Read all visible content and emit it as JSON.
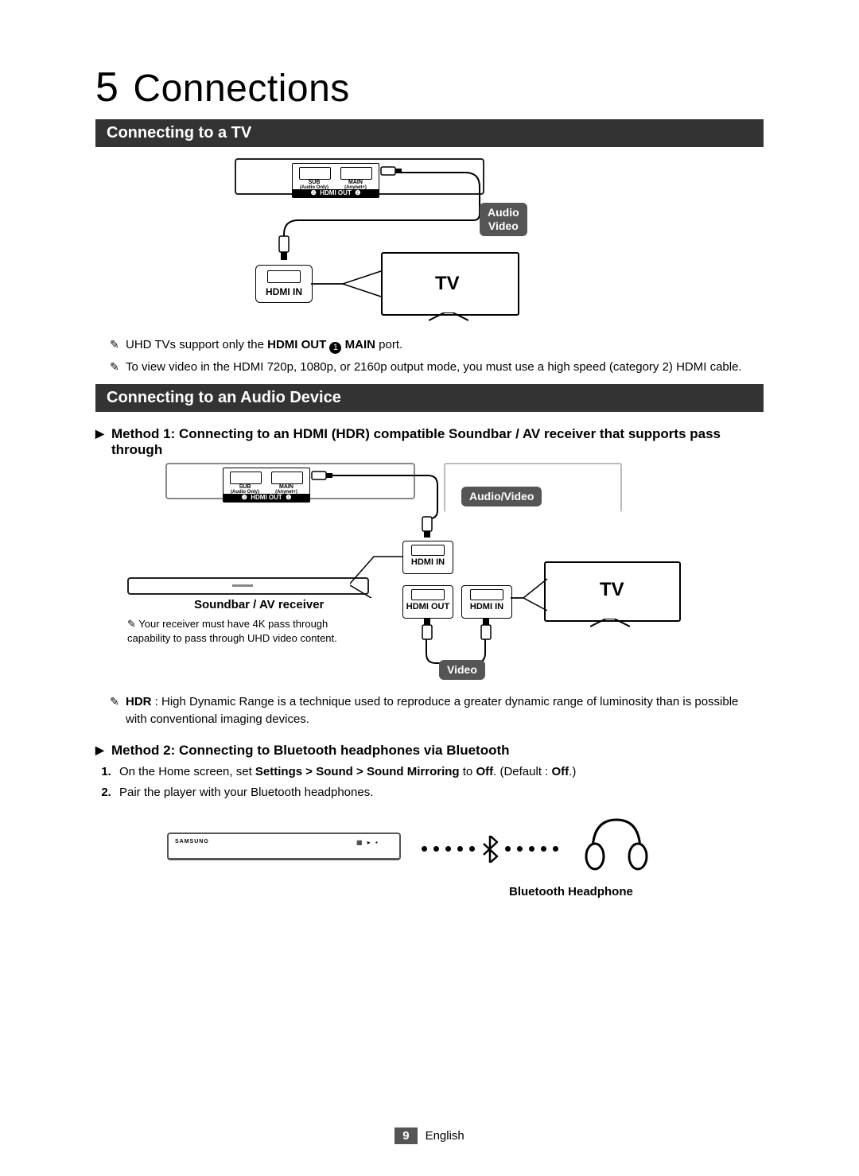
{
  "chapter": {
    "number": "5",
    "title": "Connections"
  },
  "section1": {
    "title": "Connecting to a TV",
    "diagram": {
      "pill_audio": "Audio",
      "pill_video": "Video",
      "tv": "TV",
      "hdmi_in": "HDMI IN",
      "hdmi_out_strip": "HDMI OUT",
      "sub": "SUB",
      "sub_sub": "(Audio Only)",
      "main": "MAIN",
      "main_sub": "(Anynet+)",
      "num1": "❶",
      "num2": "❷"
    },
    "notes": [
      {
        "pre": "UHD TVs support only the ",
        "b1": "HDMI OUT ",
        "circ": "1",
        "b2": " MAIN",
        "post": " port."
      },
      {
        "text": "To view video in the HDMI 720p, 1080p, or 2160p output mode, you must use a high speed (category 2) HDMI cable."
      }
    ]
  },
  "section2": {
    "title": "Connecting to an Audio Device",
    "method1": {
      "heading": "Method 1: Connecting to an HDMI (HDR) compatible Soundbar / AV receiver that supports pass through",
      "diagram": {
        "pill_av": "Audio/Video",
        "pill_video": "Video",
        "hdmi_in": "HDMI IN",
        "hdmi_out": "HDMI OUT",
        "tv": "TV",
        "soundbar_label": "Soundbar / AV receiver",
        "hdmi_out_strip": "HDMI OUT",
        "sub": "SUB",
        "sub_sub": "(Audio Only)",
        "main": "MAIN",
        "main_sub": "(Anynet+)",
        "num1": "❶",
        "num2": "❷",
        "note": "Your receiver must have 4K pass through capability to pass through UHD video content."
      },
      "hdr_note": {
        "b": "HDR",
        "text": " : High Dynamic Range is a technique used to reproduce a greater dynamic range of luminosity than is possible with conventional imaging devices."
      }
    },
    "method2": {
      "heading": "Method 2: Connecting to Bluetooth headphones via Bluetooth",
      "steps": [
        {
          "pre": "On the Home screen, set ",
          "b1": "Settings > Sound > Sound Mirroring",
          "mid": " to ",
          "b2": "Off",
          "mid2": ". (Default : ",
          "b3": "Off",
          "post": ".)"
        },
        {
          "text": "Pair the player with your Bluetooth headphones."
        }
      ],
      "headphone_label": "Bluetooth Headphone"
    }
  },
  "footer": {
    "page": "9",
    "lang": "English"
  }
}
